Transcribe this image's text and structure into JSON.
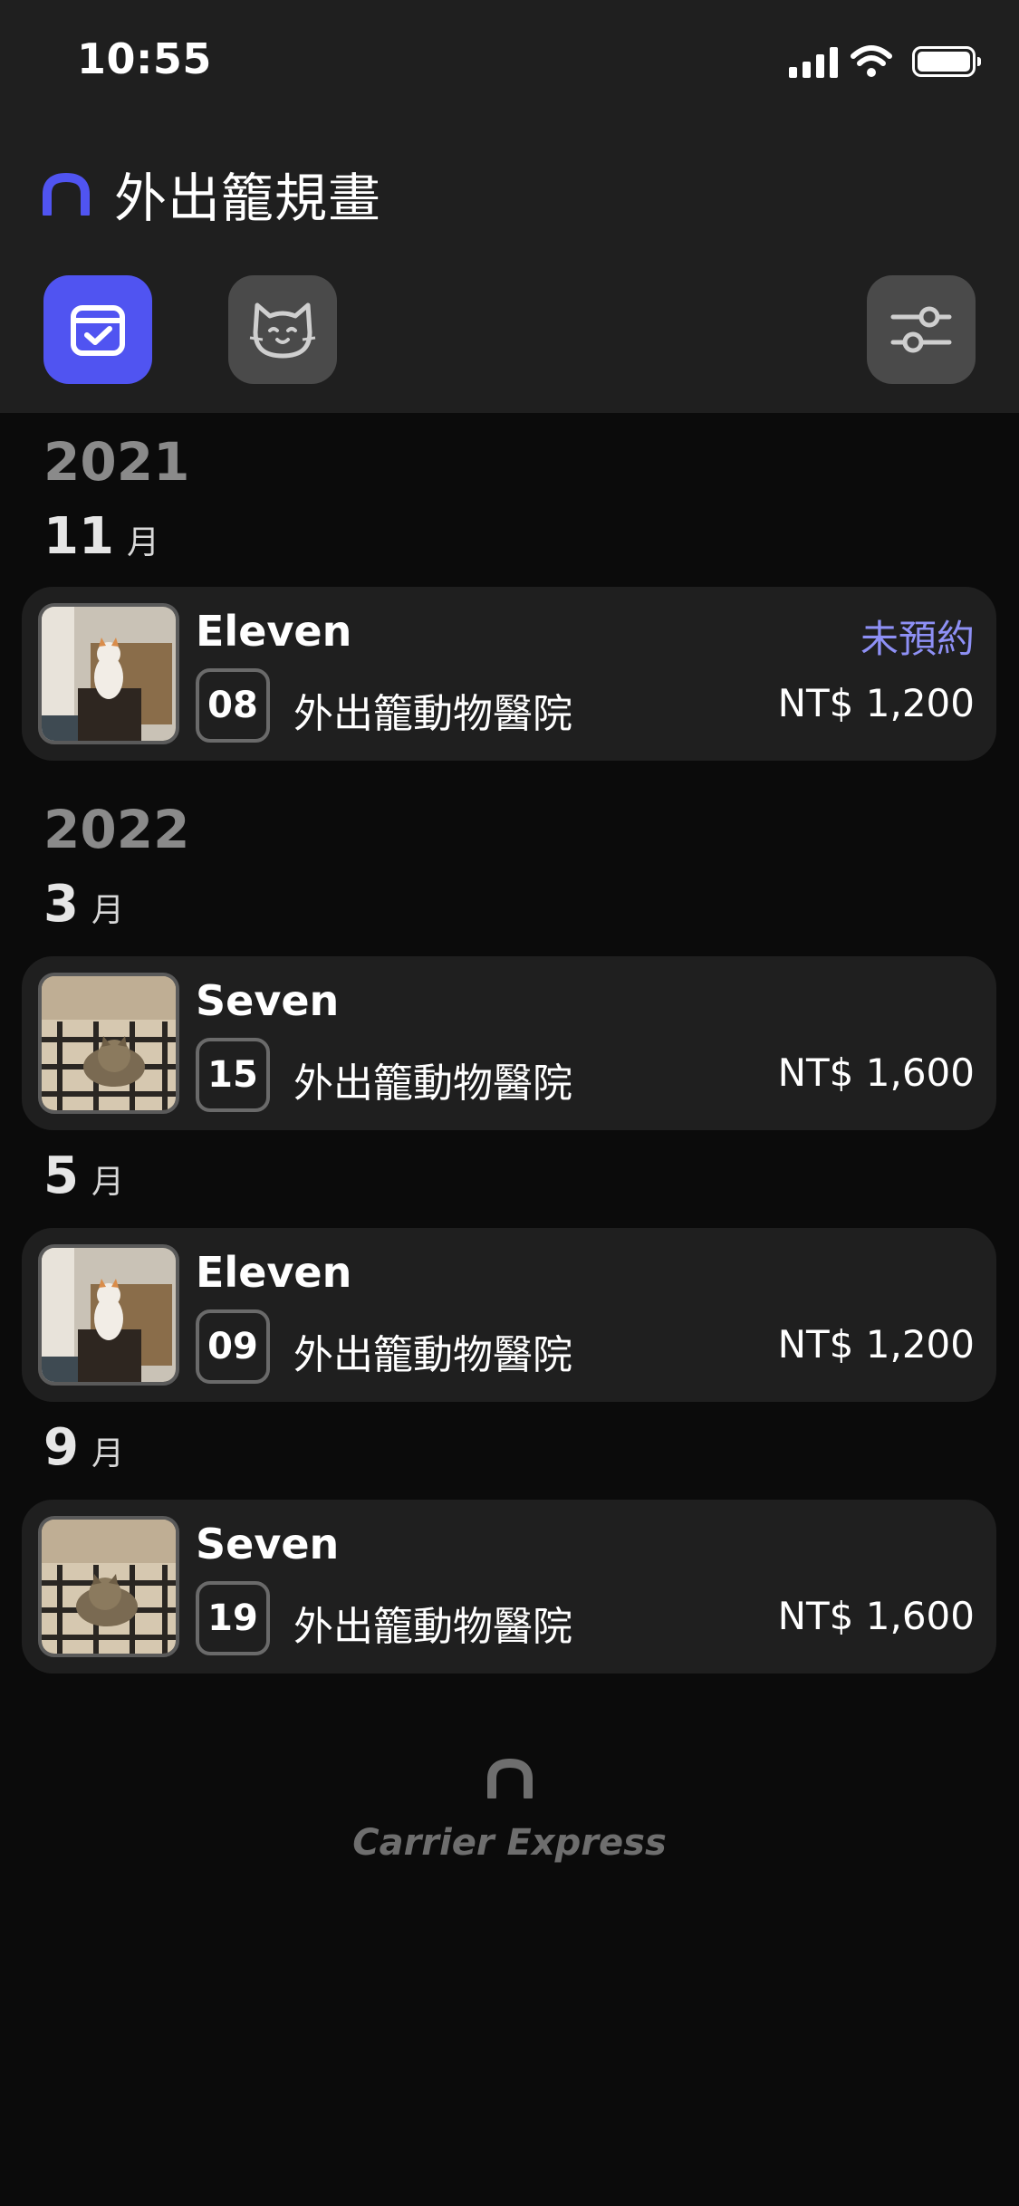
{
  "status_bar": {
    "time": "10:55"
  },
  "header": {
    "title": "外出籠規畫",
    "buttons": [
      {
        "name": "calendar-check-icon",
        "active": true
      },
      {
        "name": "cat-icon",
        "active": false
      },
      {
        "name": "sliders-icon",
        "active": false
      }
    ]
  },
  "colors": {
    "accent": "#5054f1",
    "status_unbooked": "#8e90f5",
    "card": "#1f1f1f",
    "background": "#0b0b0b"
  },
  "groups": [
    {
      "year": "2021",
      "month": "11",
      "month_unit": "月"
    },
    {
      "year": "2022",
      "month": "3",
      "month_unit": "月"
    },
    {
      "month": "5",
      "month_unit": "月"
    },
    {
      "month": "9",
      "month_unit": "月"
    }
  ],
  "appointments": [
    {
      "cat": "Eleven",
      "status": "未預約",
      "day": "08",
      "clinic": "外出籠動物醫院",
      "price": "NT$ 1,200",
      "photo": "white-orange-cat-on-box"
    },
    {
      "cat": "Seven",
      "day": "15",
      "clinic": "外出籠動物醫院",
      "price": "NT$ 1,600",
      "photo": "tabby-cat-on-plaid-blanket"
    },
    {
      "cat": "Eleven",
      "day": "09",
      "clinic": "外出籠動物醫院",
      "price": "NT$ 1,200",
      "photo": "white-orange-cat-on-box"
    },
    {
      "cat": "Seven",
      "day": "19",
      "clinic": "外出籠動物醫院",
      "price": "NT$ 1,600",
      "photo": "tabby-cat-on-plaid-blanket"
    }
  ],
  "footer": {
    "brand": "Carrier Express"
  }
}
